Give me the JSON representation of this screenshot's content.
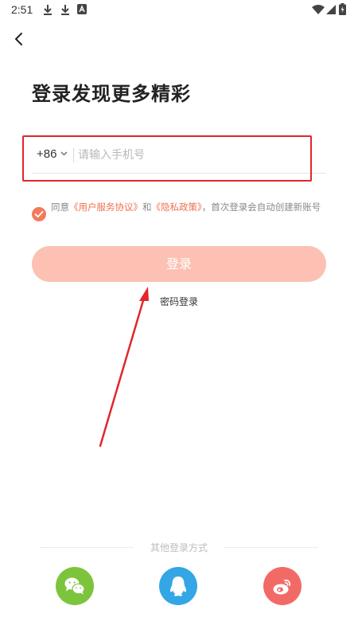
{
  "status_bar": {
    "time": "2:51",
    "icons": [
      "download-icon",
      "download-icon",
      "app-a-icon",
      "wifi-icon",
      "signal-icon",
      "battery-icon"
    ]
  },
  "header": {
    "back_icon": "chevron-left-icon",
    "title": "登录发现更多精彩"
  },
  "phone": {
    "country_code": "+86",
    "placeholder": "请输入手机号",
    "value": ""
  },
  "agreement": {
    "checked": true,
    "prefix": "同意",
    "user_agreement": "《用户服务协议》",
    "and": "和",
    "privacy_policy": "《隐私政策》",
    "suffix": "，首次登录会自动创建新账号"
  },
  "login_button": {
    "label": "登录"
  },
  "password_login": {
    "label": "密码登录"
  },
  "other_login": {
    "label": "其他登录方式",
    "providers": [
      {
        "name": "wechat",
        "icon": "wechat-icon",
        "color": "#7dc43d"
      },
      {
        "name": "qq",
        "icon": "qq-icon",
        "color": "#33a6e6"
      },
      {
        "name": "weibo",
        "icon": "weibo-icon",
        "color": "#f26a66"
      }
    ]
  },
  "colors": {
    "accent": "#f47a5c",
    "login_button_disabled": "#fcc1b3",
    "highlight_box": "#e2262b"
  }
}
